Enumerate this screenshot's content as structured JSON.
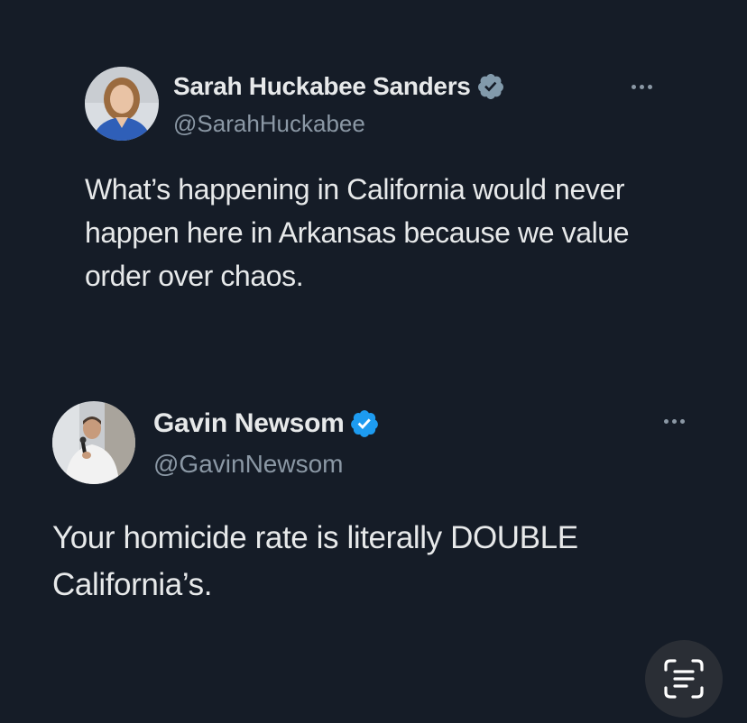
{
  "tweets": [
    {
      "name": "Sarah Huckabee Sanders",
      "handle": "@SarahHuckabee",
      "verified_color": "#829aab",
      "text": "What’s happening in California would never happen here in Arkansas because we value order over chaos."
    },
    {
      "name": "Gavin Newsom",
      "handle": "@GavinNewsom",
      "verified_color": "#1d9bf0",
      "text": "Your homicide rate is literally DOUBLE California’s."
    }
  ],
  "icons": {
    "verified": "verified-badge-icon",
    "more": "more-options-icon",
    "scan": "live-text-scan-icon"
  },
  "colors": {
    "background": "#151c27",
    "text": "#e7e9ea",
    "secondary_text": "#8b98a5"
  }
}
